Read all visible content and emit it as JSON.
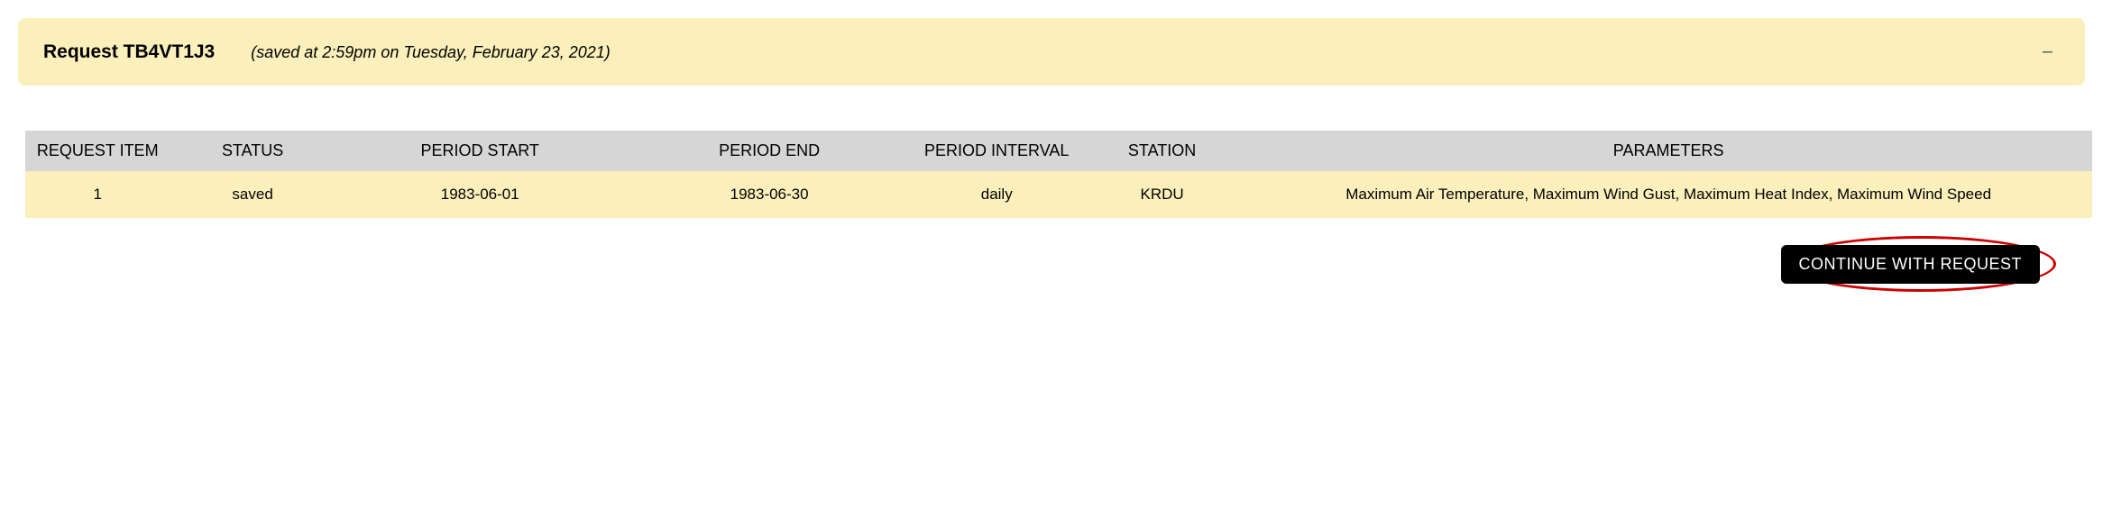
{
  "header": {
    "title": "Request TB4VT1J3",
    "saved_text": "(saved at 2:59pm on Tuesday, February 23, 2021)",
    "collapse_glyph": "–"
  },
  "table": {
    "columns": {
      "item": "REQUEST ITEM",
      "status": "STATUS",
      "period_start": "PERIOD START",
      "period_end": "PERIOD END",
      "period_interval": "PERIOD INTERVAL",
      "station": "STATION",
      "parameters": "PARAMETERS"
    },
    "rows": [
      {
        "item": "1",
        "status": "saved",
        "period_start": "1983-06-01",
        "period_end": "1983-06-30",
        "period_interval": "daily",
        "station": "KRDU",
        "parameters": "Maximum Air Temperature, Maximum Wind Gust, Maximum Heat Index, Maximum Wind Speed"
      }
    ]
  },
  "actions": {
    "continue_label": "CONTINUE WITH REQUEST"
  }
}
